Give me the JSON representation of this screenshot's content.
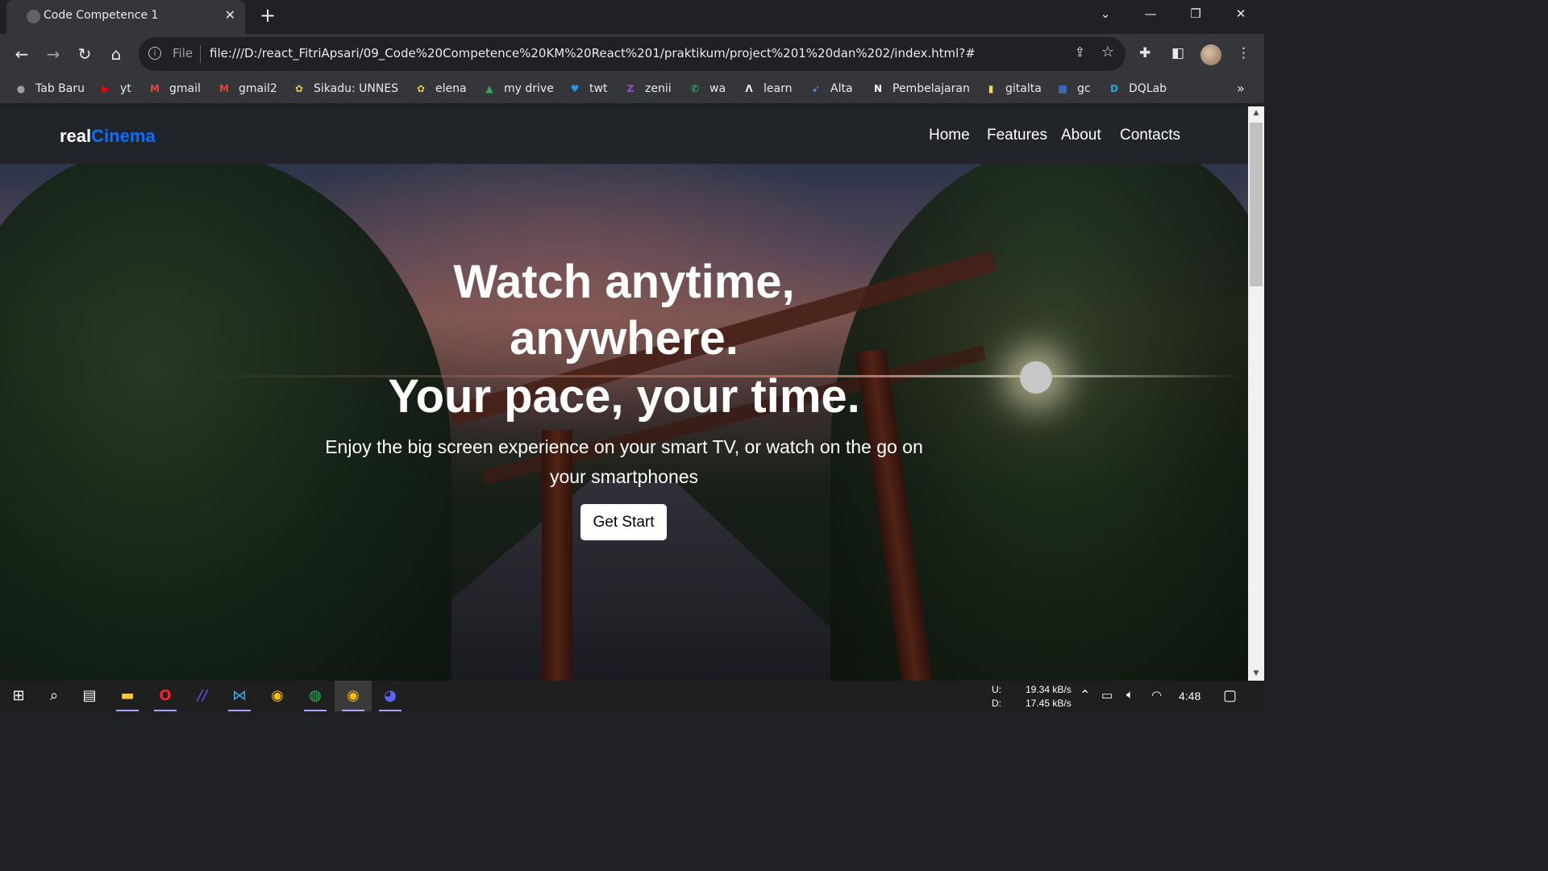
{
  "browser": {
    "tab_title": "Code Competence 1",
    "scheme_label": "File",
    "url": "file:///D:/react_FitriApsari/09_Code%20Competence%20KM%20React%201/praktikum/project%201%20dan%202/index.html?#",
    "bookmarks": [
      {
        "label": "Tab Baru",
        "icon": "globe-icon",
        "color": "#9aa0a6"
      },
      {
        "label": "yt",
        "icon": "youtube-icon",
        "color": "#ff0000"
      },
      {
        "label": "gmail",
        "icon": "gmail-icon",
        "color": "#ea4335"
      },
      {
        "label": "gmail2",
        "icon": "gmail-icon",
        "color": "#ea4335"
      },
      {
        "label": "Sikadu: UNNES",
        "icon": "unnes-icon",
        "color": "#e5c54a"
      },
      {
        "label": "elena",
        "icon": "unnes-icon",
        "color": "#e5c54a"
      },
      {
        "label": "my drive",
        "icon": "drive-icon",
        "color": "#34a853"
      },
      {
        "label": "twt",
        "icon": "twitter-icon",
        "color": "#1d9bf0"
      },
      {
        "label": "zenii",
        "icon": "zenius-icon",
        "color": "#a545d8"
      },
      {
        "label": "wa",
        "icon": "whatsapp-icon",
        "color": "#25d366"
      },
      {
        "label": "learn",
        "icon": "learn-icon",
        "color": "#e8eaed"
      },
      {
        "label": "Alta",
        "icon": "alta-icon",
        "color": "#5b8def"
      },
      {
        "label": "Pembelajaran",
        "icon": "notion-icon",
        "color": "#ffffff"
      },
      {
        "label": "gitalta",
        "icon": "folder-icon",
        "color": "#f6d86b"
      },
      {
        "label": "gc",
        "icon": "calendar-icon",
        "color": "#4285f4"
      },
      {
        "label": "DQLab",
        "icon": "dqlab-icon",
        "color": "#2aa7e0"
      }
    ]
  },
  "page": {
    "brand_prefix": "real",
    "brand_accent": "Cinema",
    "brand_accent_color": "#0d6efd",
    "nav": [
      "Home",
      "Features",
      "About",
      "Contacts"
    ],
    "hero": {
      "line1": "Watch anytime,",
      "line2": "anywhere.",
      "line3": "Your pace, your time.",
      "lead": "Enjoy the big screen experience on your smart TV, or watch on the go on your smartphones",
      "cta": "Get Start"
    }
  },
  "taskbar": {
    "apps": [
      "windows-start-icon",
      "search-icon",
      "task-view-icon",
      "file-explorer-icon",
      "opera-icon",
      "slash-app-icon",
      "vscode-icon",
      "chrome-icon",
      "spotify-icon",
      "chrome-icon",
      "discord-icon"
    ],
    "upload_label": "U:",
    "download_label": "D:",
    "upload_speed": "19.34 kB/s",
    "download_speed": "17.45 kB/s",
    "time": "4:48"
  }
}
